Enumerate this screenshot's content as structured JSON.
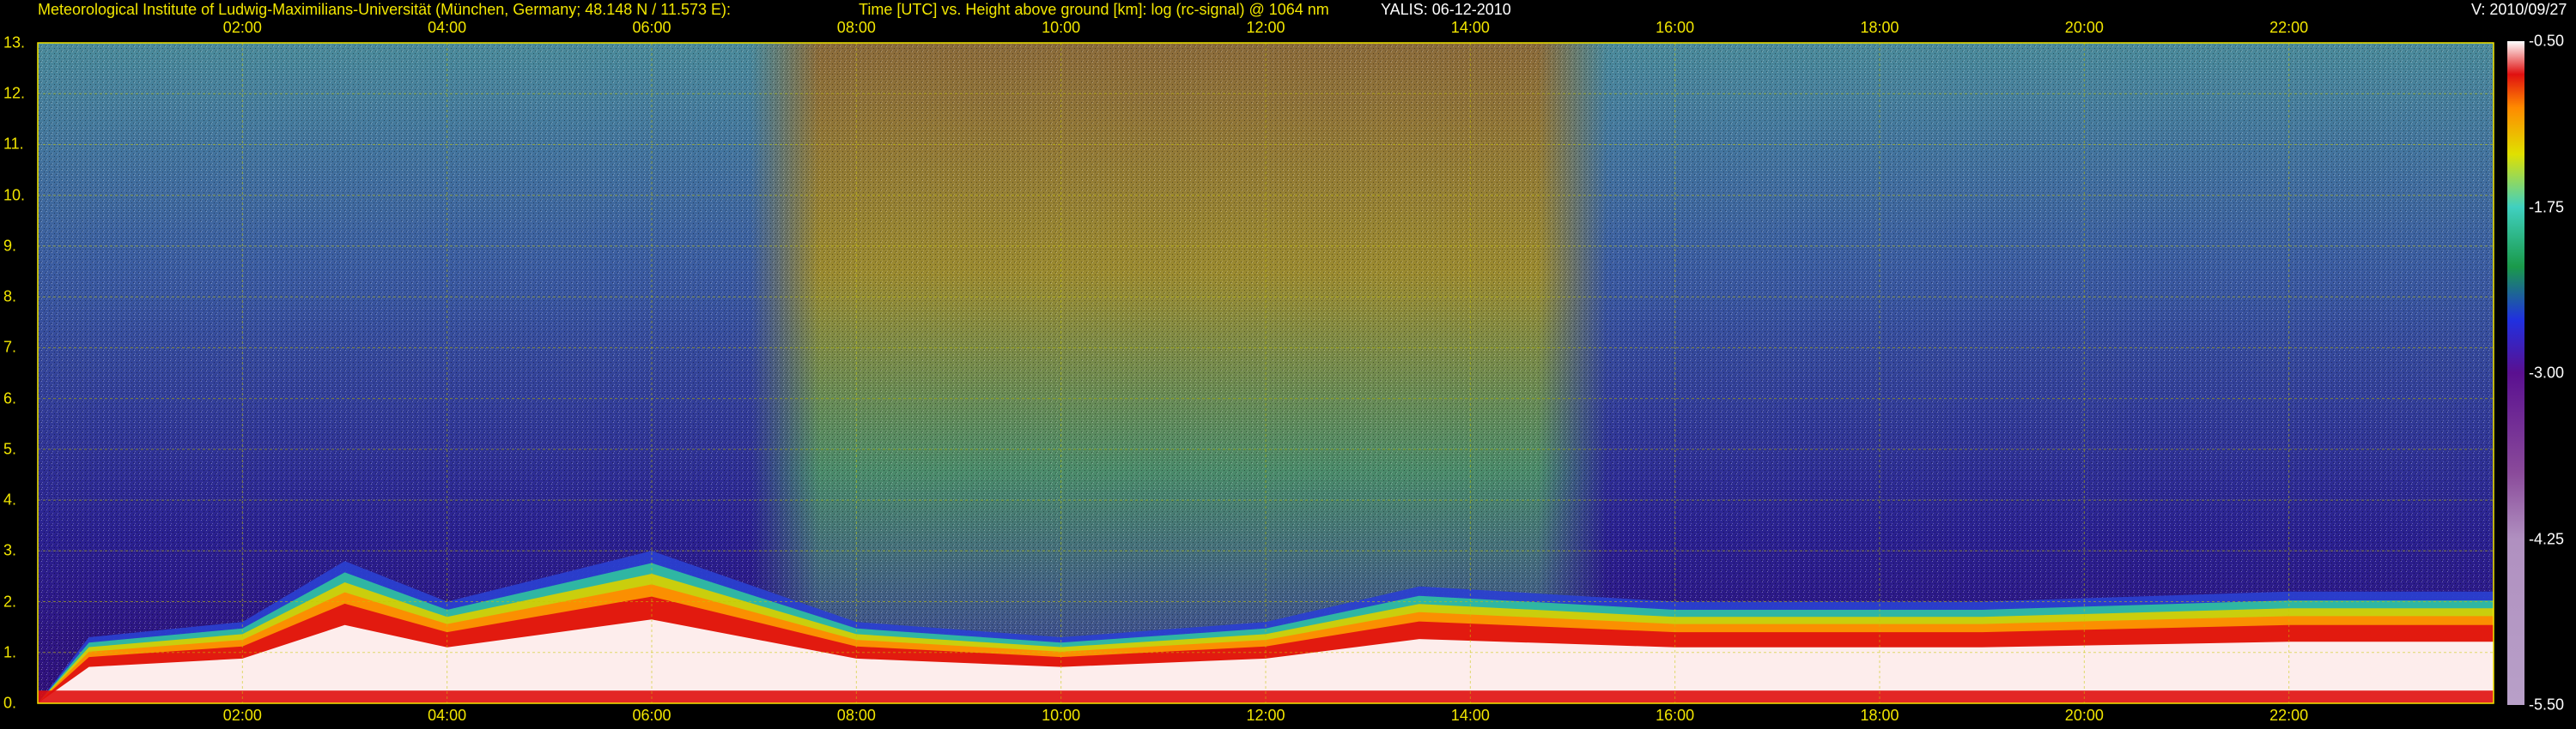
{
  "header": {
    "institute": "Meteorological Institute of Ludwig-Maximilians-Universität (München, Germany; 48.148 N / 11.573 E):",
    "description": "Time [UTC] vs. Height above ground [km]: log (rc-signal) @ 1064 nm",
    "station": "YALIS: 06-12-2010",
    "version": "V: 2010/09/27"
  },
  "colors": {
    "axis_text": "#f2e600",
    "grid": "#c8c800",
    "background": "#000000"
  },
  "chart_data": {
    "type": "heatmap",
    "title": "Time [UTC] vs. Height above ground [km]: log (rc-signal) @ 1064 nm",
    "xlabel": "Time [UTC]",
    "ylabel": "Height above ground [km]",
    "x_ticks": [
      "02:00",
      "04:00",
      "06:00",
      "08:00",
      "10:00",
      "12:00",
      "14:00",
      "16:00",
      "18:00",
      "20:00",
      "22:00"
    ],
    "x_tick_hours": [
      2,
      4,
      6,
      8,
      10,
      12,
      14,
      16,
      18,
      20,
      22
    ],
    "x_range_hours": [
      0,
      24
    ],
    "y_ticks": [
      "0.",
      "1.",
      "2.",
      "3.",
      "4.",
      "5.",
      "6.",
      "7.",
      "8.",
      "9.",
      "10.",
      "11.",
      "12.",
      "13."
    ],
    "y_tick_values": [
      0,
      1,
      2,
      3,
      4,
      5,
      6,
      7,
      8,
      9,
      10,
      11,
      12,
      13
    ],
    "y_range_km": [
      0,
      13
    ],
    "colorbar": {
      "label": "log (rc-signal)",
      "range": [
        -5.5,
        -0.5
      ],
      "tick_labels": [
        "-0.50",
        "-1.75",
        "-3.00",
        "-4.25",
        "-5.50"
      ],
      "tick_values": [
        -0.5,
        -1.75,
        -3.0,
        -4.25,
        -5.5
      ]
    },
    "grid": true,
    "boundary_layer_top_km": [
      {
        "hour": 0.5,
        "height": 1.3
      },
      {
        "hour": 2.0,
        "height": 1.6
      },
      {
        "hour": 3.0,
        "height": 2.8
      },
      {
        "hour": 4.0,
        "height": 2.0
      },
      {
        "hour": 6.0,
        "height": 3.0
      },
      {
        "hour": 8.0,
        "height": 1.6
      },
      {
        "hour": 10.0,
        "height": 1.3
      },
      {
        "hour": 12.0,
        "height": 1.6
      },
      {
        "hour": 13.5,
        "height": 2.3
      },
      {
        "hour": 16.0,
        "height": 2.0
      },
      {
        "hour": 19.0,
        "height": 2.0
      },
      {
        "hour": 22.0,
        "height": 2.2
      },
      {
        "hour": 23.8,
        "height": 2.2
      }
    ],
    "daylight_hours": [
      7.3,
      15.0
    ]
  }
}
